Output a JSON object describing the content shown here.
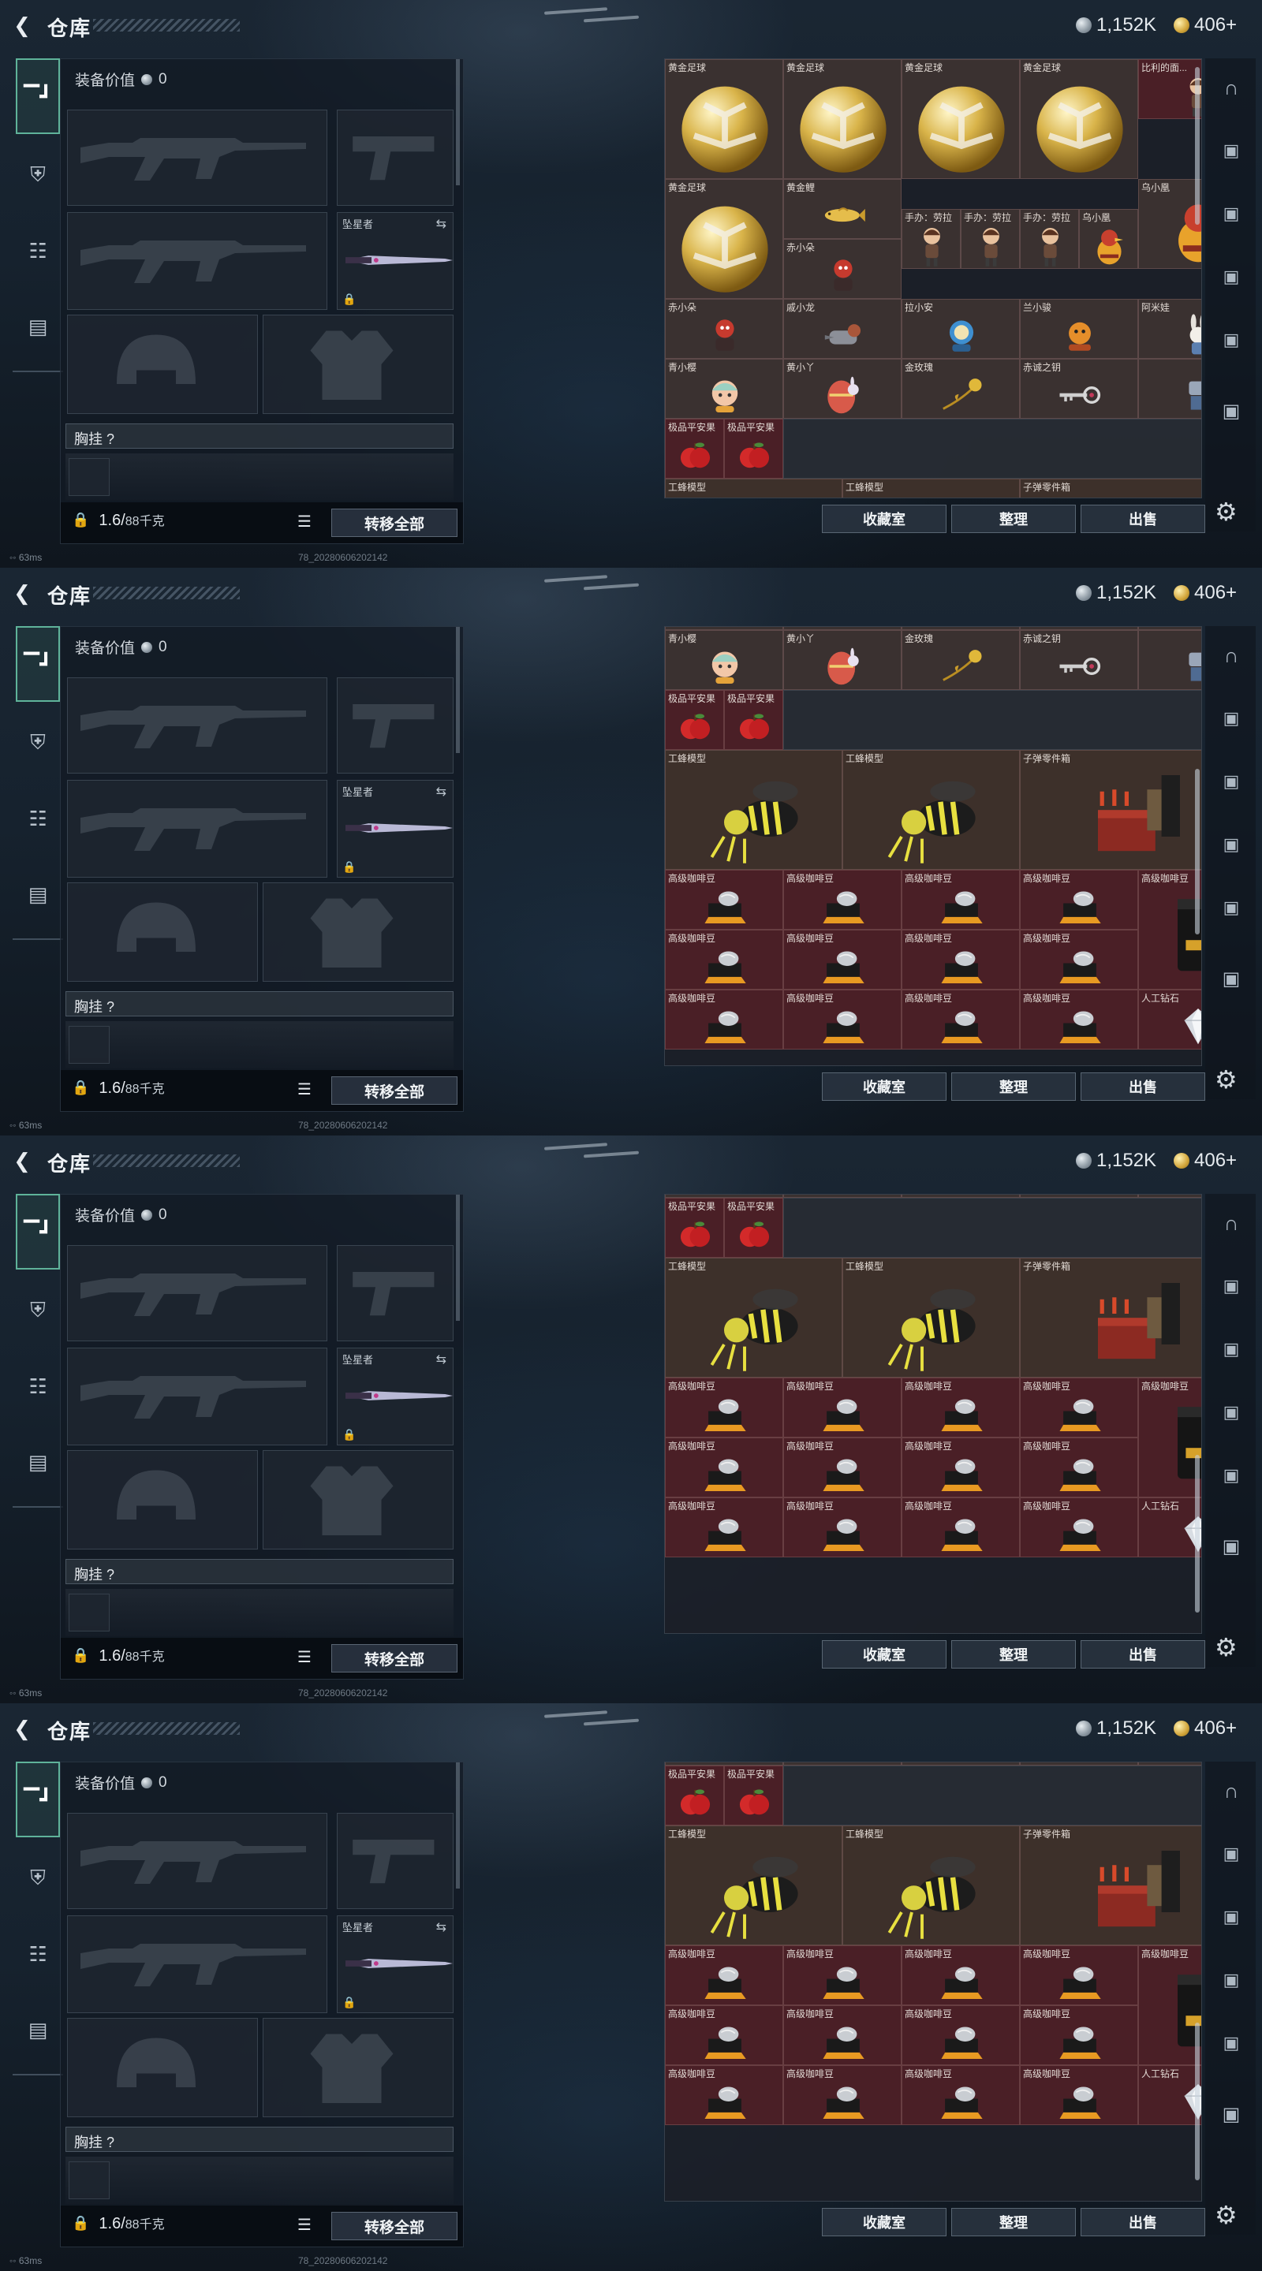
{
  "header": {
    "title": "仓库",
    "silver": "1,152K",
    "gold": "406+"
  },
  "nav_tabs": [
    "weapon-tab",
    "armor-tab",
    "backpack-tab",
    "case-tab"
  ],
  "equipment": {
    "value_label": "装备价值",
    "value": "0",
    "melee_label": "坠星者",
    "chest_label": "胸挂 ?",
    "weight_value": "1.6/",
    "weight_unit": "88千克",
    "transfer_label": "转移全部"
  },
  "actions": {
    "collection": "收藏室",
    "sort": "整理",
    "sell": "出售"
  },
  "status": {
    "ping": "63ms",
    "build": "78_20280606202142"
  },
  "items": {
    "gold_ball": "黄金足球",
    "collectible": "比利的面...",
    "gold_carp": "黄金鲤",
    "figure_lara": "手办：劳拉",
    "wuxiaohuang": "乌小凰",
    "chixiaoduo": "赤小朵",
    "weixiaolong": "戚小龙",
    "laxiaoan": "拉小安",
    "lanxiaojun": "兰小骏",
    "amitu": "阿米娃",
    "qingxiaoying": "青小樱",
    "huangxiaoya": "黄小丫",
    "gold_rose": "金玫瑰",
    "key": "赤诚之钥",
    "apple": "极品平安果",
    "bee_model": "工蜂模型",
    "ammo_parts": "子弹零件箱",
    "coffee": "高级咖啡豆",
    "diamond": "人工钻石"
  }
}
